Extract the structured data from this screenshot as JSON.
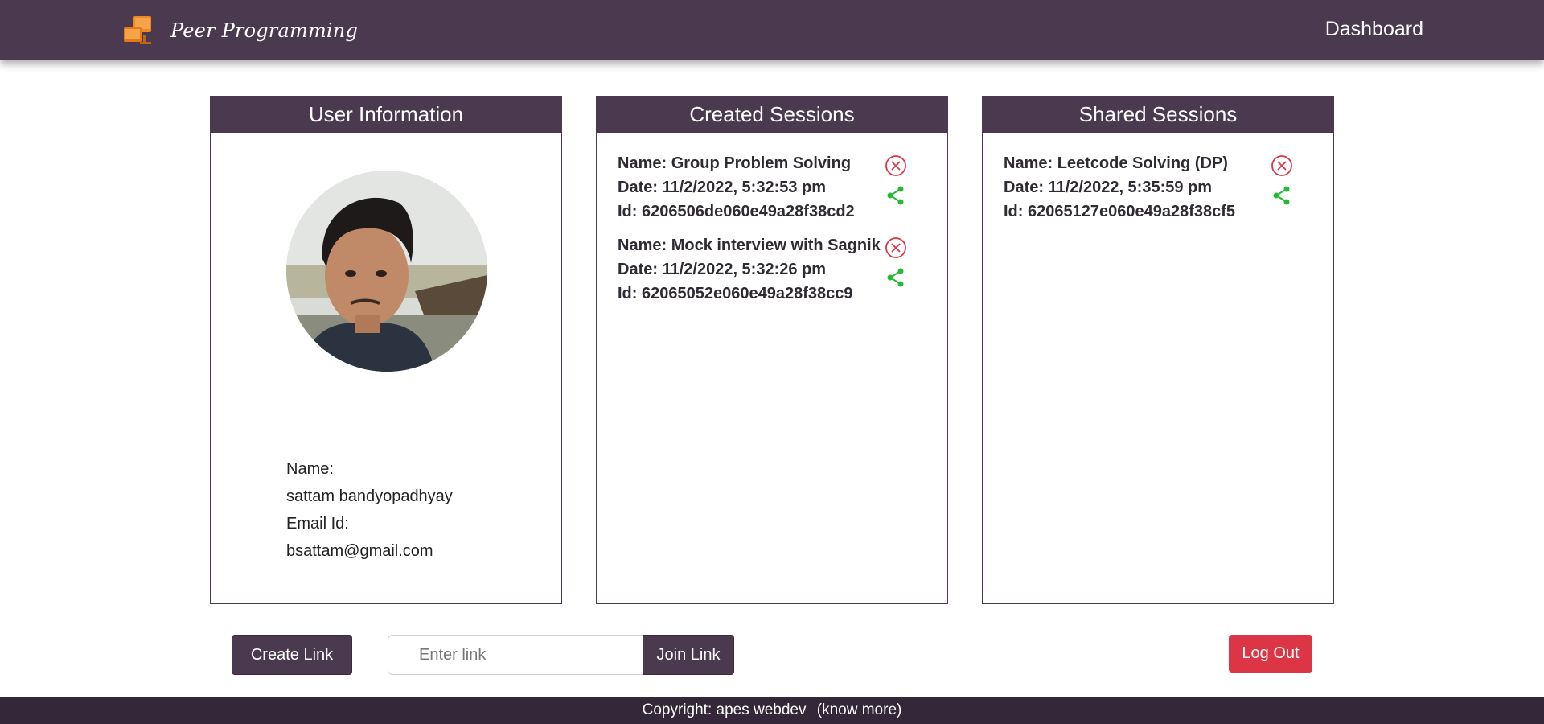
{
  "navbar": {
    "brand": "Peer Programming",
    "dashboard_link": "Dashboard"
  },
  "user_card": {
    "title": "User Information",
    "name_label": "Name:",
    "name": "sattam bandyopadhyay",
    "email_label": "Email Id:",
    "email": "bsattam@gmail.com"
  },
  "created_card": {
    "title": "Created Sessions",
    "sessions": [
      {
        "name": "Name: Group Problem Solving",
        "date": "Date: 11/2/2022, 5:32:53 pm",
        "id": "Id: 6206506de060e49a28f38cd2"
      },
      {
        "name": "Name: Mock interview with Sagnik",
        "date": "Date: 11/2/2022, 5:32:26 pm",
        "id": "Id: 62065052e060e49a28f38cc9"
      }
    ]
  },
  "shared_card": {
    "title": "Shared Sessions",
    "sessions": [
      {
        "name": "Name: Leetcode Solving (DP)",
        "date": "Date: 11/2/2022, 5:35:59 pm",
        "id": "Id: 62065127e060e49a28f38cf5"
      }
    ]
  },
  "controls": {
    "create_link": "Create Link",
    "link_placeholder": "Enter link",
    "join_link": "Join Link",
    "logout": "Log Out"
  },
  "footer": {
    "copyright": "Copyright: apes webdev",
    "know_more": "(know more)"
  },
  "colors": {
    "primary": "#4b3a4f",
    "footer": "#34273a",
    "danger": "#dc3545",
    "share": "#22bb33",
    "delete": "#dc3545"
  }
}
